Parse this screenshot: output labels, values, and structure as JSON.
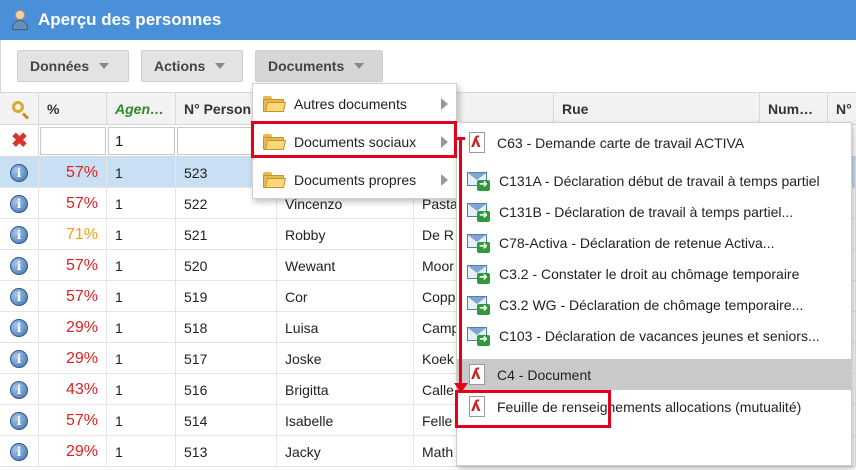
{
  "window": {
    "title": "Aperçu des personnes",
    "icon": "user-icon"
  },
  "toolbar": {
    "donnees": "Données",
    "actions": "Actions",
    "documents": "Documents"
  },
  "grid": {
    "headers": {
      "percent": "%",
      "agence": "Agen…",
      "numero": "N° Person",
      "nom": "",
      "prenom": "",
      "rue": "Rue",
      "num": "Num…",
      "no": "N°"
    },
    "filter": {
      "agence": "1"
    },
    "rows": [
      {
        "pct": "57%",
        "pct_color": "#e02020",
        "agence": "1",
        "num": "523",
        "prenom": "",
        "nom": "",
        "selected": true
      },
      {
        "pct": "57%",
        "pct_color": "#e02020",
        "agence": "1",
        "num": "522",
        "prenom": "Vincenzo",
        "nom": "Pasta"
      },
      {
        "pct": "71%",
        "pct_color": "#f0a010",
        "agence": "1",
        "num": "521",
        "prenom": "Robby",
        "nom": "De R"
      },
      {
        "pct": "57%",
        "pct_color": "#e02020",
        "agence": "1",
        "num": "520",
        "prenom": "Wewant",
        "nom": "Moor"
      },
      {
        "pct": "57%",
        "pct_color": "#e02020",
        "agence": "1",
        "num": "519",
        "prenom": "Cor",
        "nom": "Copp"
      },
      {
        "pct": "29%",
        "pct_color": "#e02020",
        "agence": "1",
        "num": "518",
        "prenom": "Luisa",
        "nom": "Camp"
      },
      {
        "pct": "29%",
        "pct_color": "#e02020",
        "agence": "1",
        "num": "517",
        "prenom": "Joske",
        "nom": "Koek"
      },
      {
        "pct": "43%",
        "pct_color": "#e02020",
        "agence": "1",
        "num": "516",
        "prenom": "Brigitta",
        "nom": "Calle"
      },
      {
        "pct": "57%",
        "pct_color": "#e02020",
        "agence": "1",
        "num": "514",
        "prenom": "Isabelle",
        "nom": "Felle"
      },
      {
        "pct": "29%",
        "pct_color": "#e02020",
        "agence": "1",
        "num": "513",
        "prenom": "Jacky",
        "nom": "Math"
      }
    ]
  },
  "menu": {
    "items": [
      {
        "label": "Autres documents"
      },
      {
        "label": "Documents sociaux"
      },
      {
        "label": "Documents propres"
      }
    ]
  },
  "submenu": {
    "items": [
      {
        "label": "C63 - Demande carte de travail ACTIVA",
        "icon": "pdf-icon"
      },
      {
        "label": "C131A - Déclaration début de travail à temps partiel",
        "icon": "mail-icon"
      },
      {
        "label": "C131B - Déclaration de travail à temps partiel...",
        "icon": "mail-icon"
      },
      {
        "label": "C78-Activa - Déclaration de retenue Activa...",
        "icon": "mail-icon"
      },
      {
        "label": "C3.2 - Constater le droit au chômage temporaire",
        "icon": "mail-icon"
      },
      {
        "label": "C3.2 WG - Déclaration de chômage temporaire...",
        "icon": "mail-icon"
      },
      {
        "label": "C103 - Déclaration de vacances jeunes et seniors...",
        "icon": "mail-icon"
      },
      {
        "label": "C4 - Document",
        "icon": "pdf-icon"
      },
      {
        "label": "Feuille de renseignements allocations (mutualité)",
        "icon": "pdf-icon"
      }
    ]
  },
  "colors": {
    "titlebar": "#4a90d9",
    "highlight": "#e4001b",
    "selected_row": "#c9dff3"
  }
}
